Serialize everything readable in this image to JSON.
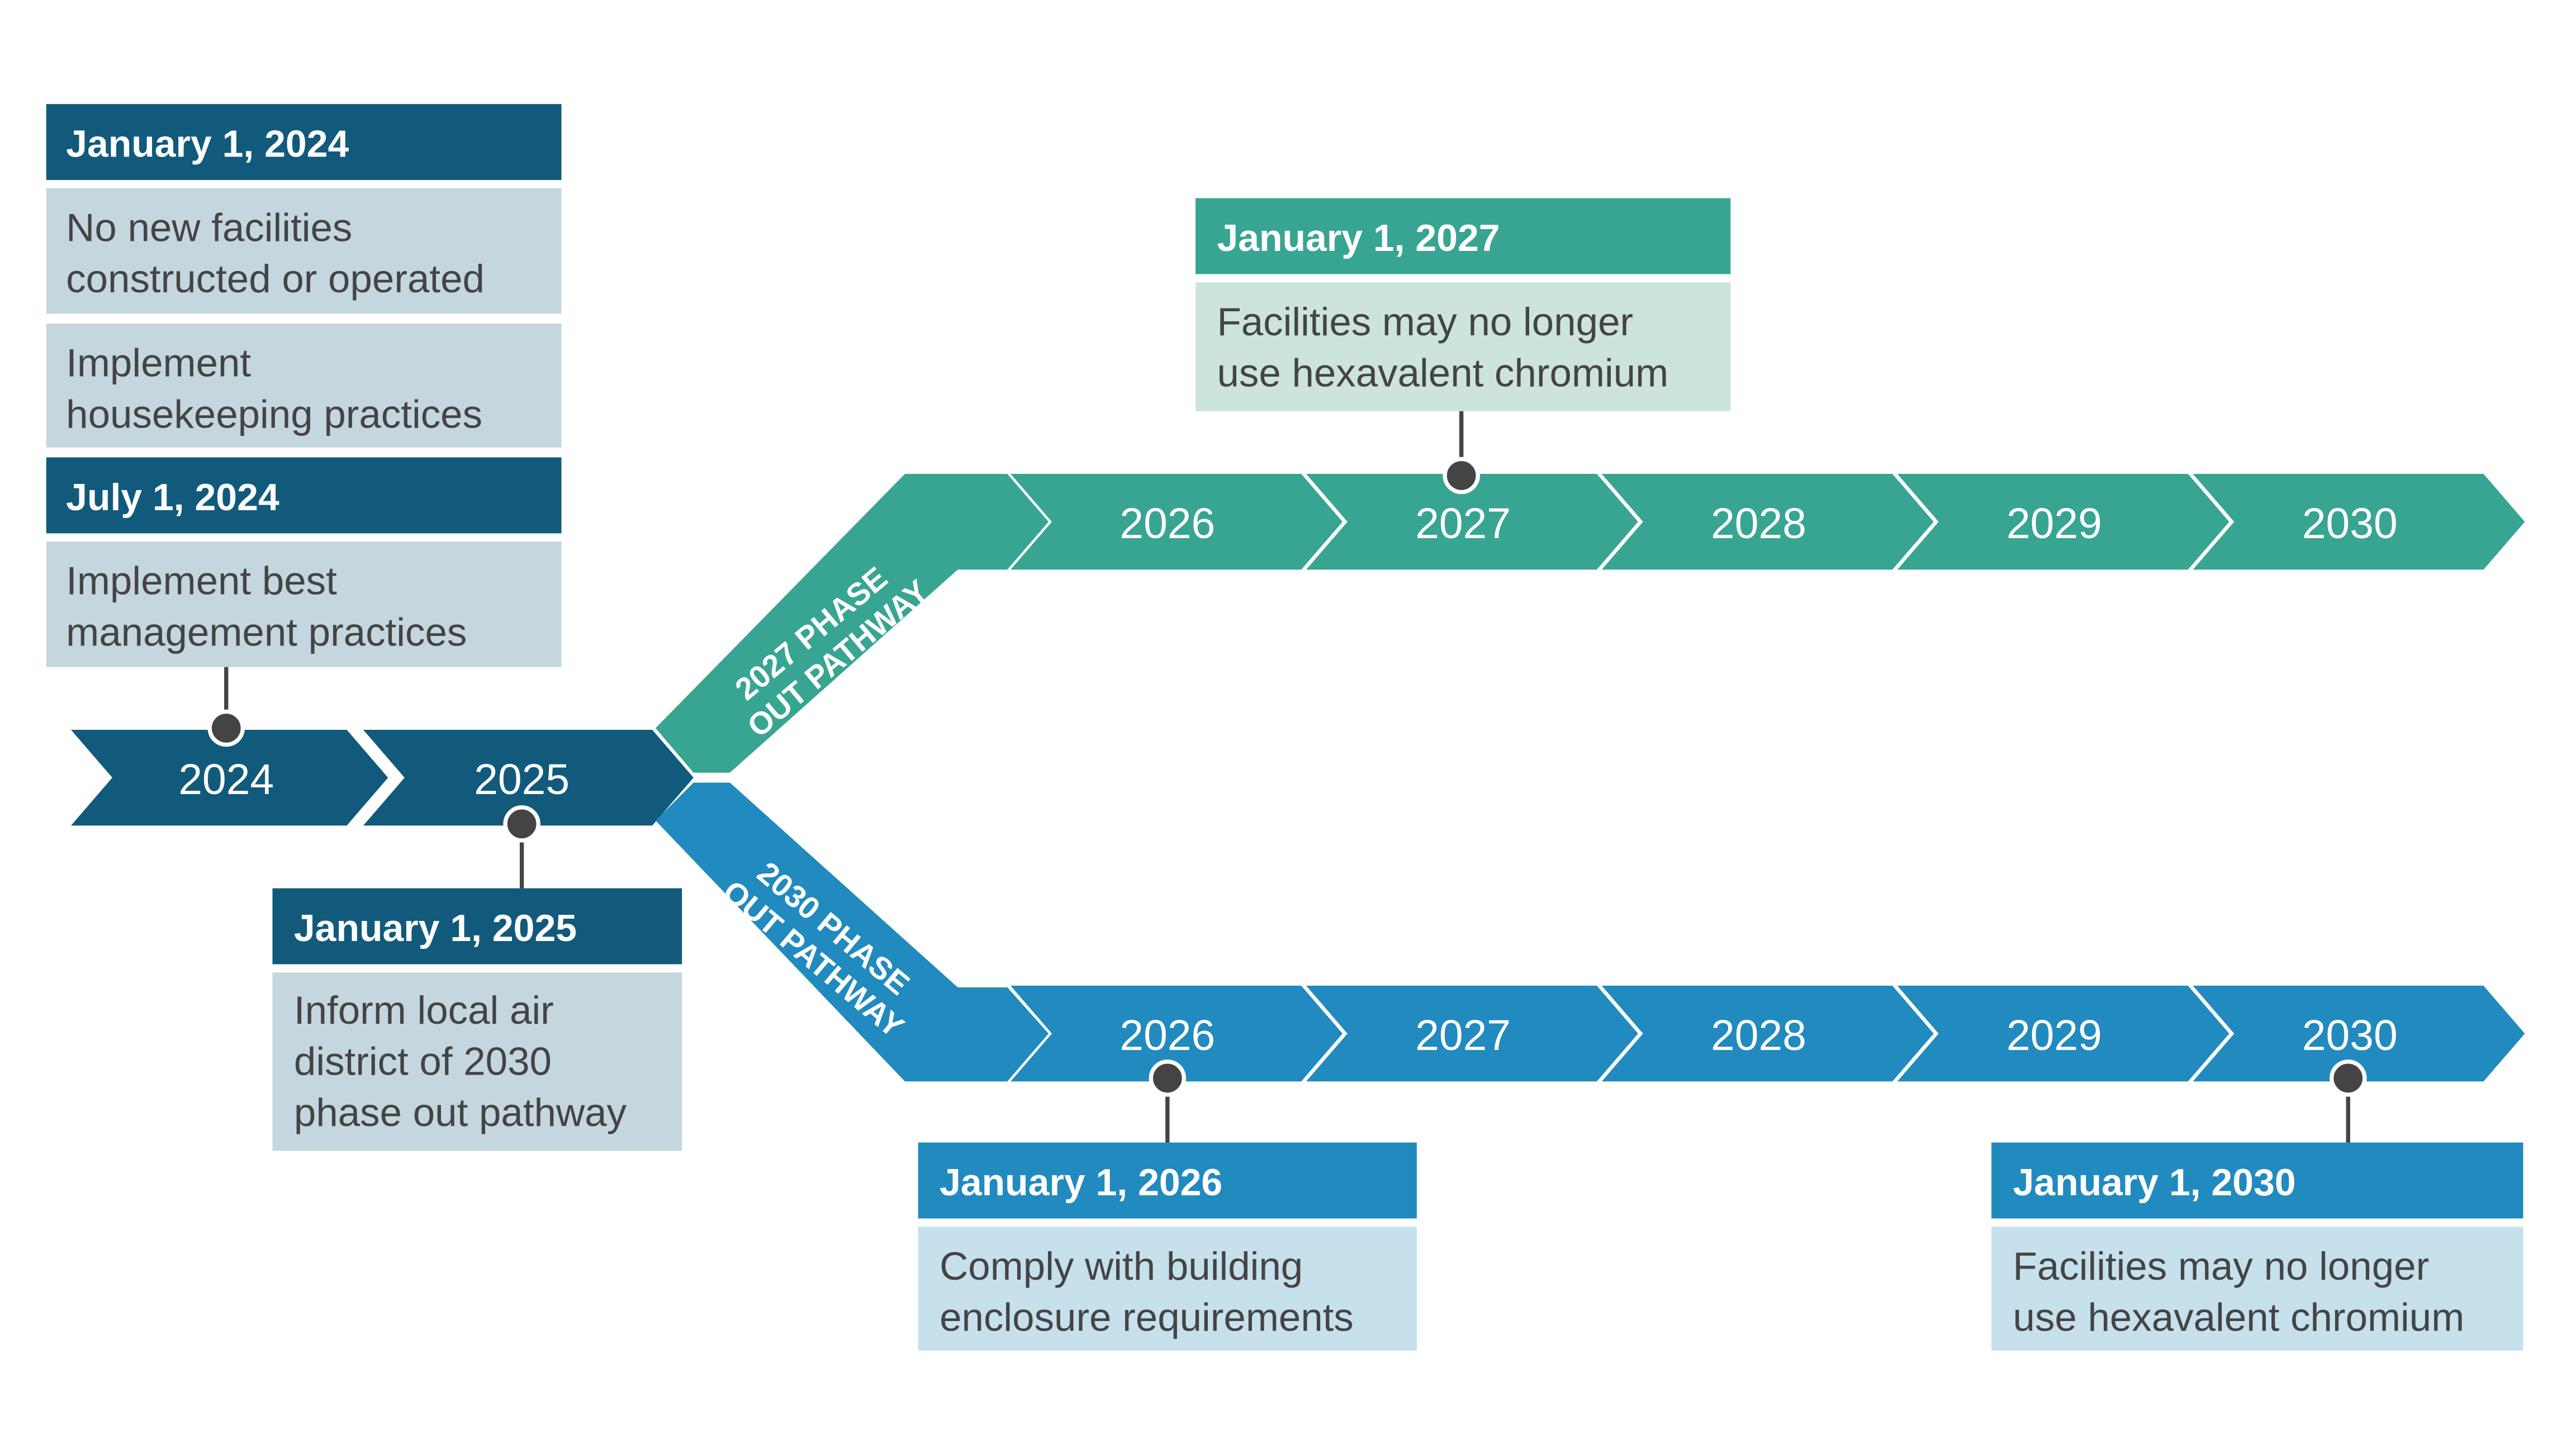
{
  "colors": {
    "dark": "#115a7c",
    "teal": "#37a591",
    "blue": "#218abf",
    "dark_light": "#c4d6de",
    "teal_light": "#cde3dd",
    "blue_light": "#c6e0ec",
    "text": "#444444",
    "marker": "#444444"
  },
  "base_years": [
    "2024",
    "2025"
  ],
  "pathway_2027": {
    "label_lines": [
      "2027 PHASE",
      "OUT PATHWAY"
    ],
    "years": [
      "2026",
      "2027",
      "2028",
      "2029",
      "2030"
    ]
  },
  "pathway_2030": {
    "label_lines": [
      "2030 PHASE",
      "OUT PATHWAY"
    ],
    "years": [
      "2026",
      "2027",
      "2028",
      "2029",
      "2030"
    ]
  },
  "milestones": {
    "m2024": {
      "date": "January 1, 2024",
      "items": [
        [
          "No new facilities",
          "constructed or operated"
        ],
        [
          "Implement",
          "housekeeping practices"
        ]
      ]
    },
    "m2024b": {
      "date": "July 1, 2024",
      "items": [
        [
          "Implement best",
          "management practices"
        ]
      ]
    },
    "m2025": {
      "date": "January 1, 2025",
      "items": [
        [
          "Inform local air",
          "district of 2030",
          "phase out pathway"
        ]
      ]
    },
    "m2027": {
      "date": "January 1, 2027",
      "items": [
        [
          "Facilities may no longer",
          "use hexavalent chromium"
        ]
      ]
    },
    "m2026": {
      "date": "January 1, 2026",
      "items": [
        [
          "Comply with building",
          "enclosure requirements"
        ]
      ]
    },
    "m2030": {
      "date": "January 1, 2030",
      "items": [
        [
          "Facilities may no longer",
          "use hexavalent chromium"
        ]
      ]
    }
  }
}
